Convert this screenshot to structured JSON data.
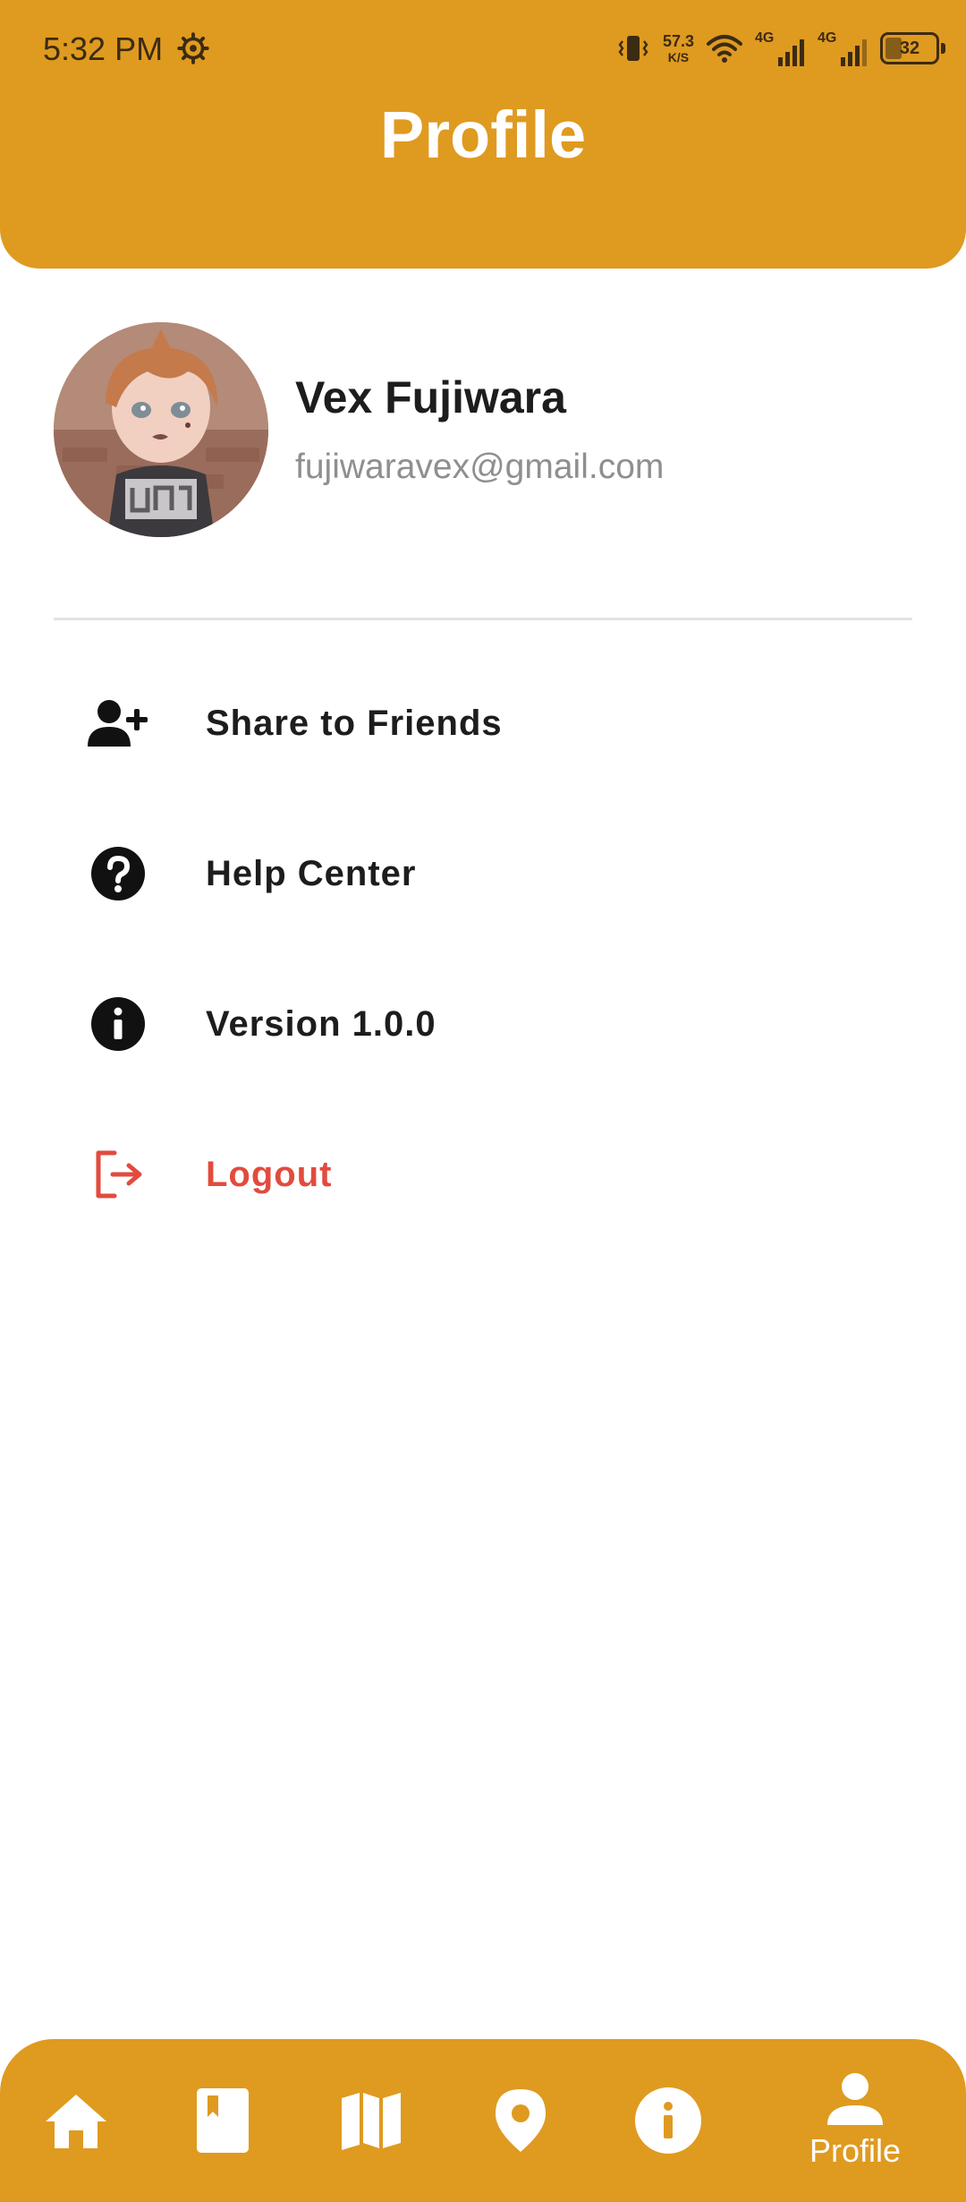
{
  "status_bar": {
    "time": "5:32 PM",
    "net_speed_value": "57.3",
    "net_speed_unit": "K/S",
    "signal1_tag": "4G",
    "signal2_tag": "4G",
    "battery": "32"
  },
  "header": {
    "title": "Profile"
  },
  "profile": {
    "name": "Vex Fujiwara",
    "email": "fujiwaravex@gmail.com"
  },
  "menu": {
    "items": [
      {
        "label": "Share to Friends",
        "icon": "add-user-icon"
      },
      {
        "label": "Help Center",
        "icon": "question-circle-icon"
      },
      {
        "label": "Version 1.0.0",
        "icon": "info-circle-icon"
      },
      {
        "label": "Logout",
        "icon": "logout-icon"
      }
    ]
  },
  "bottom_nav": {
    "items": [
      {
        "icon": "home-icon",
        "label": ""
      },
      {
        "icon": "book-icon",
        "label": ""
      },
      {
        "icon": "map-icon",
        "label": ""
      },
      {
        "icon": "location-pin-icon",
        "label": ""
      },
      {
        "icon": "info-icon",
        "label": ""
      },
      {
        "icon": "person-icon",
        "label": "Profile",
        "active": true
      }
    ]
  },
  "colors": {
    "accent": "#DF9A20",
    "logout": "#E24B3D",
    "text": "#1D1D1D",
    "muted": "#8F8F8F"
  }
}
